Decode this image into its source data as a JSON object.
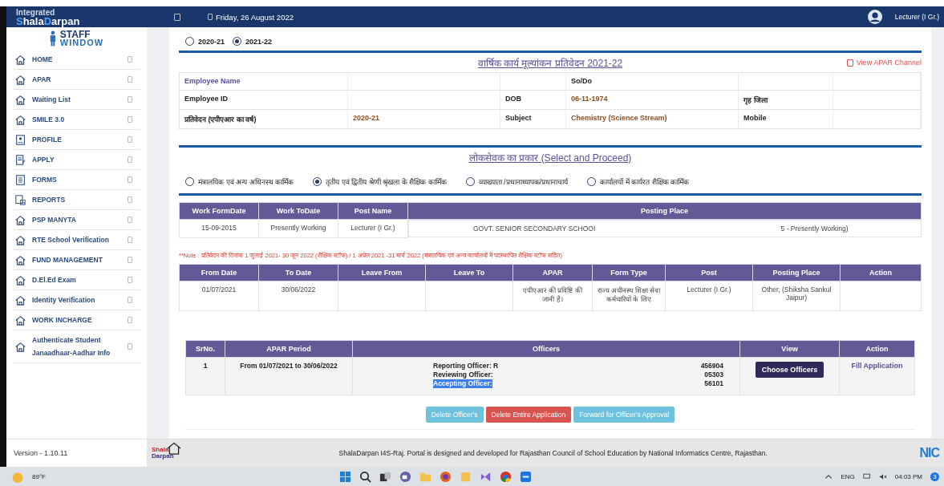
{
  "header": {
    "brand_top": "Integrated",
    "brand": [
      {
        "text": "S",
        "accent": true
      },
      {
        "text": "hala",
        "accent": false
      },
      {
        "text": "D",
        "accent": true
      },
      {
        "text": "arpan",
        "accent": false
      }
    ],
    "date": "Friday, 26 August 2022",
    "user_role": "Lecturer (I Gr.)"
  },
  "sidebar": {
    "logo_top": "STAFF",
    "logo_bottom": "WINDOW",
    "items": [
      {
        "label": "HOME",
        "kind": "home"
      },
      {
        "label": "APAR",
        "kind": "home"
      },
      {
        "label": "Waiting List",
        "kind": "home"
      },
      {
        "label": "SMILE 3.0",
        "kind": "home"
      },
      {
        "label": "PROFILE",
        "kind": "profile"
      },
      {
        "label": "APPLY",
        "kind": "apply"
      },
      {
        "label": "FORMS",
        "kind": "forms"
      },
      {
        "label": "REPORTS",
        "kind": "reports"
      },
      {
        "label": "PSP MANYTA",
        "kind": "home"
      },
      {
        "label": "RTE School Verification",
        "kind": "home"
      },
      {
        "label": "FUND MANAGEMENT",
        "kind": "home"
      },
      {
        "label": "D.El.Ed Exam",
        "kind": "home"
      },
      {
        "label": "Identity Verification",
        "kind": "home"
      },
      {
        "label": "WORK INCHARGE",
        "kind": "home"
      },
      {
        "label": "Authenticate Student Janaadhaar-Aadhar Info",
        "kind": "home"
      }
    ],
    "version": "Version - 1.10.11"
  },
  "session": {
    "options": [
      {
        "label": "2020-21",
        "selected": false
      },
      {
        "label": "2021-22",
        "selected": true
      }
    ]
  },
  "report": {
    "title": "वार्षिक कार्य मूल्यांकन प्रतिवेदन 2021-22",
    "view_link": "View APAR Channel"
  },
  "info_table": {
    "rows": [
      [
        {
          "kind": "name",
          "text": "Employee Name"
        },
        {
          "kind": "blank"
        },
        {
          "kind": "blank"
        },
        {
          "kind": "label",
          "text": "So/Do"
        },
        {
          "kind": "blank"
        },
        {
          "kind": "blank"
        }
      ],
      [
        {
          "kind": "label",
          "text": "Employee ID"
        },
        {
          "kind": "blank"
        },
        {
          "kind": "label",
          "text": "DOB"
        },
        {
          "kind": "value",
          "text": "06-11-1974"
        },
        {
          "kind": "label",
          "text": "गृह जिला"
        },
        {
          "kind": "blank"
        }
      ],
      [
        {
          "kind": "label",
          "text": "प्रतिवेदन (एपीएआर का वर्ष)"
        },
        {
          "kind": "value",
          "text": "2020-21"
        },
        {
          "kind": "label",
          "text": "Subject"
        },
        {
          "kind": "value",
          "text": "Chemistry (Science Stream)"
        },
        {
          "kind": "label",
          "text": "Mobile"
        },
        {
          "kind": "blank"
        }
      ]
    ]
  },
  "employee_type": {
    "title": "लोकसेवक का प्रकार (Select and Proceed)",
    "options": [
      {
        "label": "मंत्रालयिक एवं अन्य अधिनस्थ कार्मिक",
        "selected": false
      },
      {
        "label": "तृतीय एवं द्वितीय श्रेणी श्रृंखला के शैक्षिक कार्मिक",
        "selected": true
      },
      {
        "label": "व्याख्याता /प्रधानाध्यापक/प्रधानाचार्य",
        "selected": false
      },
      {
        "label": "कार्यालयों में कार्यरत शैक्षिक कार्मिक",
        "selected": false
      }
    ]
  },
  "work_table": {
    "columns": [
      "Work FormDate",
      "Work ToDate",
      "Post Name",
      "Posting Place"
    ],
    "rows": [
      {
        "from": "15-09-2015",
        "to": "Presently Working",
        "post": "Lecturer (I Gr.)",
        "place": [
          "GOVT. SENIOR SECONDARY SCHOOI",
          "5 - Presently Working)"
        ]
      }
    ]
  },
  "note": "**Note : प्रतिवेदन की दिनांक 1 जुलाई 2021- 30 जून 2022 (शैक्षिक स्टॉफ) / 1 अप्रेल 2021 -31 मार्च 2022 (मंत्रालयिक एवं अन्य कार्यालयों में पदस्थापित शैक्षिक स्टॉफ सहित)",
  "leave_table": {
    "columns": [
      "From Date",
      "To Date",
      "Leave From",
      "Leave To",
      "APAR",
      "Form Type",
      "Post",
      "Posting Place",
      "Action"
    ],
    "rows": [
      [
        "01/07/2021",
        "30/06/2022",
        null,
        null,
        "एपीएआर की प्रविष्टि की जानी है।",
        "राज्य अधीनस्थ शिक्षा सेवा कर्मचारियों के लिए",
        "Lecturer (I Gr.)",
        "Other, (Shiksha Sankul Jaipur)",
        null
      ]
    ]
  },
  "officers_table": {
    "columns": [
      "SrNo.",
      "APAR Period",
      "Officers",
      "View",
      "Action"
    ],
    "rows": [
      {
        "sr": "1",
        "period": "From 01/07/2021 to 30/06/2022",
        "officers": [
          {
            "role": "Reporting Officer: R",
            "code": "456904",
            "selected": false
          },
          {
            "role": "Reviewing Officer:",
            "code": "05303",
            "selected": false
          },
          {
            "role": "Accepting Officer:",
            "code": "56101",
            "selected": true
          }
        ],
        "view_button": "Choose Officers",
        "action_link": "Fill Application"
      }
    ]
  },
  "actions": [
    {
      "label": "Delete Officer's",
      "kind": "info"
    },
    {
      "label": "Delete Entire Application",
      "kind": "danger"
    },
    {
      "label": "Forward for Officer's Approval",
      "kind": "info"
    }
  ],
  "footer": {
    "logo_top": "Shala",
    "logo_bottom": "Darpan",
    "credit": "ShalaDarpan I4S-Raj. Portal is designed and developed for Rajasthan Council of School Education by National Informatics Centre, Rajasthan.",
    "nic": "NIC"
  },
  "taskbar": {
    "weather": "89°F",
    "lang": "ENG",
    "time": "04:03 PM",
    "badge": "3"
  }
}
